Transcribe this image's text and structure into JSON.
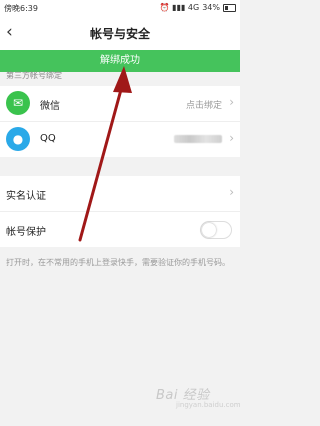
{
  "status": {
    "time": "傍晚6:39",
    "icons": "⏰ ▮▮▮ 4G",
    "battery": "34%"
  },
  "header": {
    "back_icon": "‹",
    "title": "帐号与安全"
  },
  "toast": {
    "text": "解绑成功"
  },
  "third_party": {
    "section_label": "第三方帐号绑定",
    "items": [
      {
        "icon": "wechat-icon",
        "glyph": "✉",
        "label": "微信",
        "value": "点击绑定"
      },
      {
        "icon": "qq-icon",
        "glyph": "●",
        "label": "QQ",
        "value": ""
      }
    ]
  },
  "security": {
    "items": [
      {
        "label": "实名认证"
      },
      {
        "label": "帐号保护",
        "toggle_on": false
      }
    ]
  },
  "hint": {
    "text": "打开时，在不常用的手机上登录快手，需要验证你的手机号码。"
  },
  "watermark": {
    "text": "Bai 经验",
    "sub": "jingyan.baidu.com"
  },
  "colors": {
    "accent": "#45c35c",
    "arrow": "#a01818"
  }
}
